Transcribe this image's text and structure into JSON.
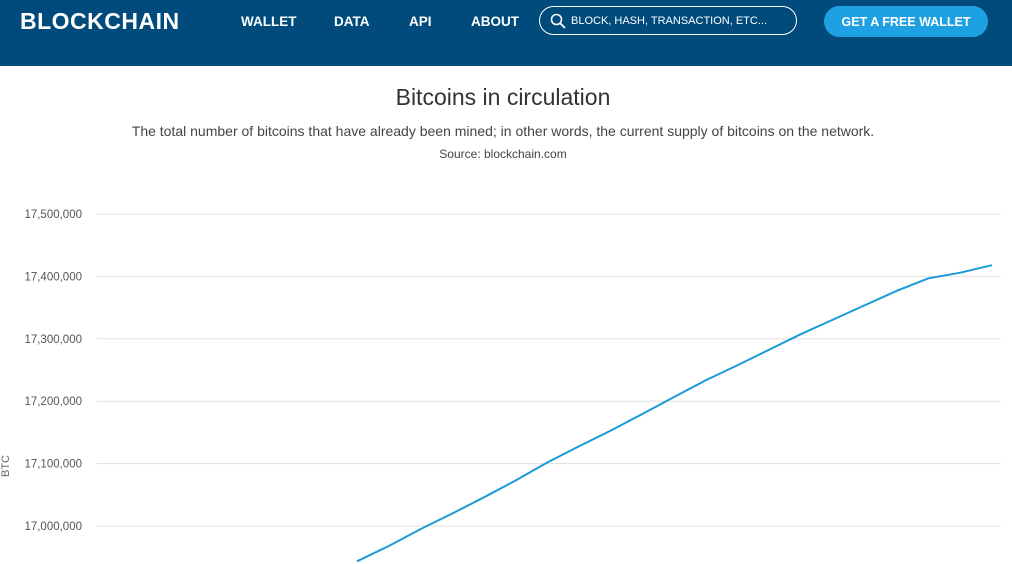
{
  "header": {
    "logo": "BLOCKCHAIN",
    "nav": [
      "WALLET",
      "DATA",
      "API",
      "ABOUT"
    ],
    "search_placeholder": "BLOCK, HASH, TRANSACTION, ETC...",
    "cta": "GET A FREE WALLET",
    "colors": {
      "bar": "#004a7c",
      "cta": "#1da1e2"
    }
  },
  "page": {
    "title": "Bitcoins in circulation",
    "subtitle": "The total number of bitcoins that have already been mined; in other words, the current supply of bitcoins on the network.",
    "source": "Source: blockchain.com"
  },
  "chart_data": {
    "type": "line",
    "ylabel": "BTC",
    "xlabel": "",
    "title": "",
    "y_ticks": [
      17000000,
      17100000,
      17200000,
      17300000,
      17400000,
      17500000
    ],
    "y_tick_labels": [
      "17,000,000",
      "17,100,000",
      "17,200,000",
      "17,300,000",
      "17,400,000",
      "17,500,000"
    ],
    "ylim": [
      16940000,
      17500000
    ],
    "grid": true,
    "series": [
      {
        "color": "#1a9ad8",
        "x": [
          0,
          5,
          10,
          15,
          20,
          25,
          30,
          35,
          40,
          45,
          50,
          55,
          60,
          65,
          70,
          75,
          80,
          85,
          90,
          95,
          100
        ],
        "y": [
          16943500,
          16968000,
          16995000,
          17020000,
          17046000,
          17073000,
          17102000,
          17128000,
          17153000,
          17180000,
          17207000,
          17234000,
          17258000,
          17283000,
          17308000,
          17331000,
          17354000,
          17377000,
          17397000,
          17406000,
          17418000
        ]
      }
    ]
  }
}
